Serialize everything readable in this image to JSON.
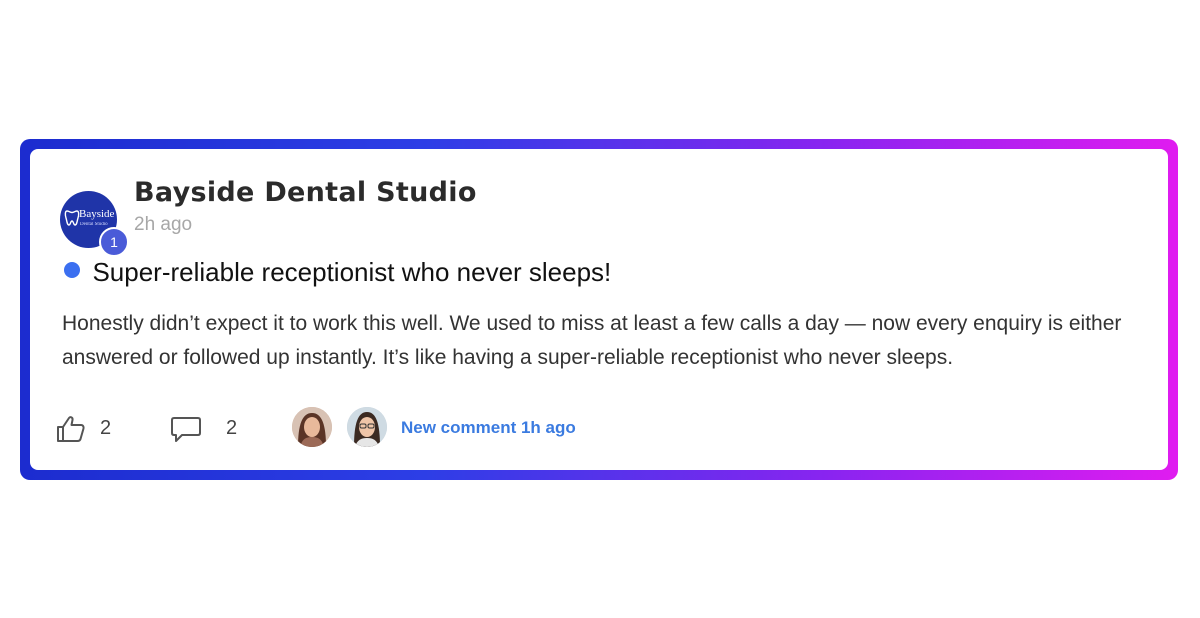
{
  "post": {
    "author": {
      "name": "Bayside Dental Studio",
      "avatar_text": "Bayside",
      "avatar_subtext": "Dental Studio",
      "badge_count": "1",
      "avatar_color": "#1f34a8"
    },
    "time_ago": "2h ago",
    "status_color": "#3b6ff0",
    "title": "Super-reliable receptionist who never sleeps!",
    "body": "Honestly didn’t expect it to work this well. We used to miss at least a few calls a day — now every enquiry is either answered or followed up instantly. It’s like having a super-reliable receptionist who never sleeps.",
    "likes": "2",
    "comments": "2",
    "new_comment_label": "New comment 1h ago",
    "link_color": "#3b7be0"
  },
  "frame": {
    "gradient_start": "#1c2ccf",
    "gradient_end": "#e01cf0"
  },
  "icons": {
    "like": "thumbs-up-icon",
    "comment": "speech-bubble-icon"
  }
}
